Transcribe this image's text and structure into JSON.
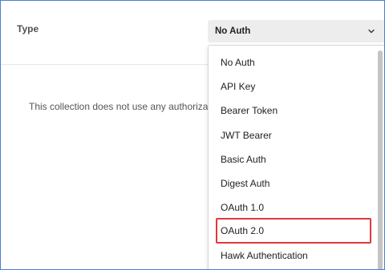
{
  "auth": {
    "type_label": "Type",
    "selected_value": "No Auth",
    "empty_message": "This collection does not use any authorization."
  },
  "dropdown": {
    "options": [
      {
        "label": "No Auth"
      },
      {
        "label": "API Key"
      },
      {
        "label": "Bearer Token"
      },
      {
        "label": "JWT Bearer"
      },
      {
        "label": "Basic Auth"
      },
      {
        "label": "Digest Auth"
      },
      {
        "label": "OAuth 1.0"
      },
      {
        "label": "OAuth 2.0"
      },
      {
        "label": "Hawk Authentication"
      }
    ],
    "highlighted_option": "OAuth 2.0"
  },
  "colors": {
    "frame_border": "#4a7fd4",
    "select_background": "#ededed",
    "highlight_border": "#e0383e"
  },
  "icons": {
    "select_chevron": "chevron-down-icon"
  }
}
